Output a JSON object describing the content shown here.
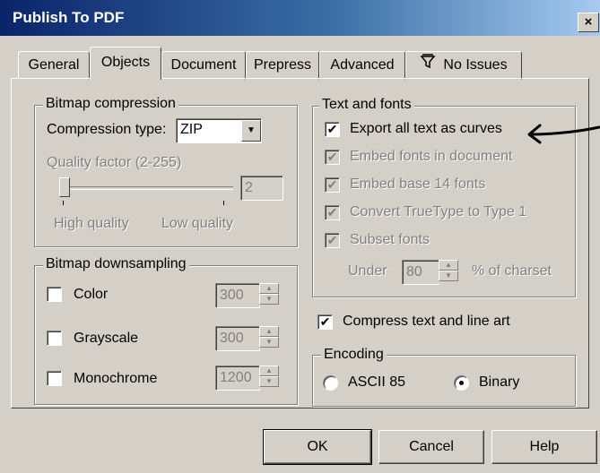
{
  "window": {
    "title": "Publish To PDF",
    "close_glyph": "×"
  },
  "tabs": [
    {
      "label": "General"
    },
    {
      "label": "Objects",
      "active": true
    },
    {
      "label": "Document"
    },
    {
      "label": "Prepress"
    },
    {
      "label": "Advanced"
    },
    {
      "label": "No Issues",
      "icon": "preflight-icon"
    }
  ],
  "bitmap_compression": {
    "legend": "Bitmap compression",
    "type_label": "Compression type:",
    "type_value": "ZIP",
    "quality_label": "Quality factor (2-255)",
    "quality_value": "2",
    "slider_level": 0.0,
    "high_label": "High quality",
    "low_label": "Low quality"
  },
  "bitmap_downsampling": {
    "legend": "Bitmap downsampling",
    "items": [
      {
        "label": "Color",
        "value": "300",
        "checked": false
      },
      {
        "label": "Grayscale",
        "value": "300",
        "checked": false
      },
      {
        "label": "Monochrome",
        "value": "1200",
        "checked": false
      }
    ]
  },
  "text_fonts": {
    "legend": "Text and fonts",
    "export_curves": {
      "label": "Export all text as curves",
      "checked": true
    },
    "embed_fonts": {
      "label": "Embed fonts in document",
      "checked": true,
      "disabled": true
    },
    "embed_base14": {
      "label": "Embed base 14 fonts",
      "checked": true,
      "disabled": true
    },
    "convert_truetype": {
      "label": "Convert TrueType to Type 1",
      "checked": true,
      "disabled": true
    },
    "subset_fonts": {
      "label": "Subset fonts",
      "checked": true,
      "disabled": true
    },
    "under_label": "Under",
    "under_value": "80",
    "charset_label": "% of charset"
  },
  "compress": {
    "label": "Compress text and line art",
    "checked": true
  },
  "encoding": {
    "legend": "Encoding",
    "options": [
      {
        "label": "ASCII 85",
        "selected": false
      },
      {
        "label": "Binary",
        "selected": true
      }
    ]
  },
  "buttons": {
    "ok": "OK",
    "cancel": "Cancel",
    "help": "Help"
  },
  "check_glyph": "✔"
}
